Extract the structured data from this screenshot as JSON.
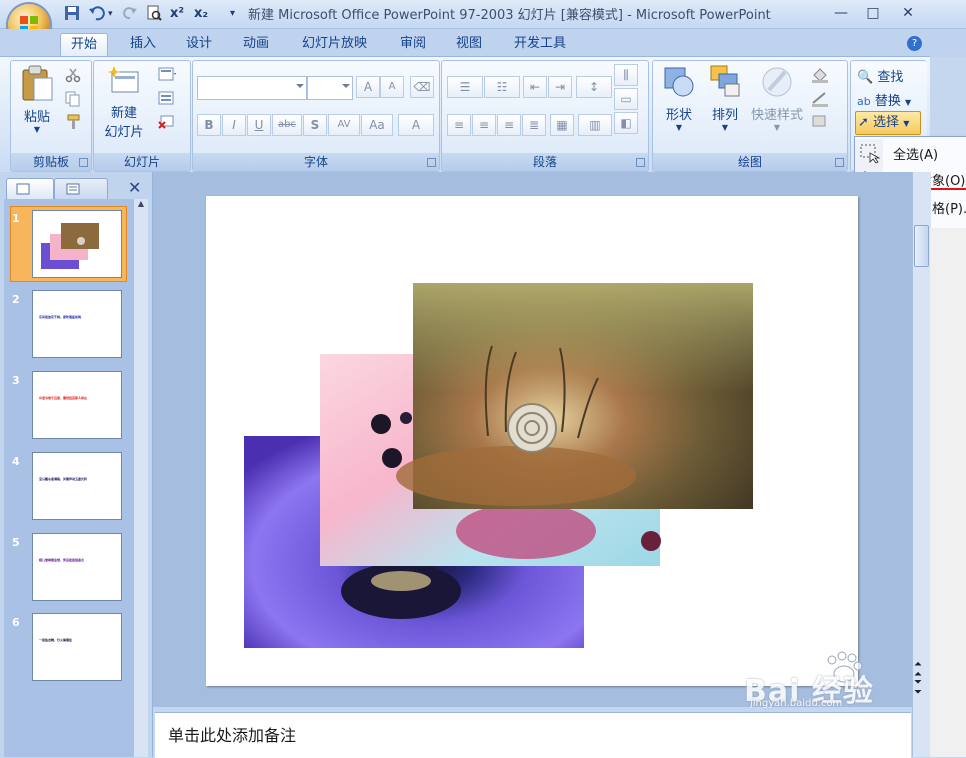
{
  "window": {
    "title": "新建 Microsoft Office PowerPoint 97-2003 幻灯片 [兼容模式] - Microsoft PowerPoint",
    "minimize": "—",
    "restore": "□",
    "close": "✕"
  },
  "qat": {
    "save": "💾",
    "undo": "↶",
    "redo": "↷",
    "superscript": "x²",
    "subscript": "x₂",
    "customize": "▾"
  },
  "tabs": [
    {
      "label": "开始",
      "active": true
    },
    {
      "label": "插入"
    },
    {
      "label": "设计"
    },
    {
      "label": "动画"
    },
    {
      "label": "幻灯片放映"
    },
    {
      "label": "审阅"
    },
    {
      "label": "视图"
    },
    {
      "label": "开发工具"
    }
  ],
  "help": "?",
  "groups": {
    "clipboard": {
      "label": "剪贴板",
      "paste": "粘贴"
    },
    "slides": {
      "label": "幻灯片",
      "new_slide_1": "新建",
      "new_slide_2": "幻灯片"
    },
    "font": {
      "label": "字体",
      "bold": "B",
      "italic": "I",
      "underline": "U",
      "strike": "abc",
      "shadow": "S",
      "spacing": "AV",
      "case": "Aa",
      "color": "A",
      "grow": "A",
      "shrink": "A"
    },
    "paragraph": {
      "label": "段落"
    },
    "drawing": {
      "label": "绘图",
      "shapes": "形状",
      "arrange": "排列",
      "quick_styles": "快速样式"
    },
    "editing": {
      "find": "查找",
      "replace": "替换",
      "select": "选择"
    }
  },
  "select_menu": {
    "items": [
      {
        "label": "全选(A)"
      },
      {
        "label": "选择对象(O)"
      },
      {
        "label": "选择窗格(P)..."
      }
    ]
  },
  "slides": [
    {
      "num": "1",
      "text": ""
    },
    {
      "num": "2",
      "text": "东风夜放花千树，更吹落星如雨",
      "color": "#1a1a9c"
    },
    {
      "num": "3",
      "text": "众里寻他千百度，蓦然回首那人却在",
      "color": "#e01010"
    },
    {
      "num": "4",
      "text": "宝马雕车香满路，凤箫声动玉壶光转",
      "color": "#1a1a6c"
    },
    {
      "num": "5",
      "text": "蛾儿雪柳黄金缕，笑语盈盈暗香去",
      "color": "#6a1a9c"
    },
    {
      "num": "6",
      "text": "一夜鱼龙舞，灯火阑珊处",
      "color": "#1a1a3c"
    }
  ],
  "notes_placeholder": "单击此处添加备注",
  "watermark": {
    "brand": "Bai 经验",
    "url": "jingyan.baidu.com"
  },
  "colors": {
    "accent": "#15428b",
    "highlight": "#e0121b"
  }
}
